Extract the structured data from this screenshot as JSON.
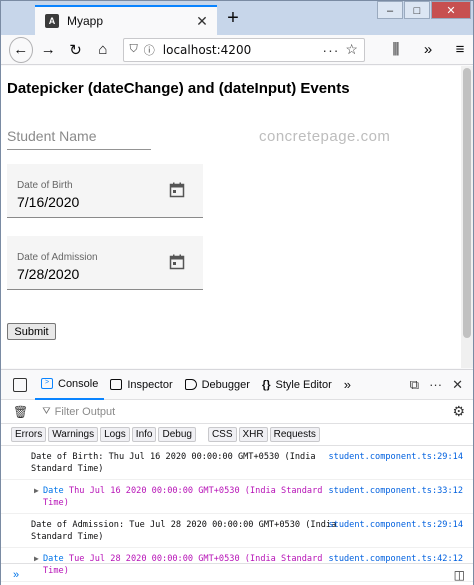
{
  "tab": {
    "title": "Myapp",
    "favicon": "angular-icon"
  },
  "window": {
    "controls": [
      "minimize",
      "maximize",
      "close"
    ]
  },
  "nav": {
    "url": "localhost:4200"
  },
  "page": {
    "title": "Datepicker (dateChange) and (dateInput) Events",
    "student_placeholder": "Student Name",
    "watermark": "concretepage.com",
    "dob": {
      "label": "Date of Birth",
      "value": "7/16/2020"
    },
    "doa": {
      "label": "Date of Admission",
      "value": "7/28/2020"
    },
    "submit_label": "Submit"
  },
  "devtools": {
    "tabs": [
      "Console",
      "Inspector",
      "Debugger",
      "Style Editor"
    ],
    "filter_placeholder": "Filter Output",
    "levels": [
      "Errors",
      "Warnings",
      "Logs",
      "Info",
      "Debug"
    ],
    "types": [
      "CSS",
      "XHR",
      "Requests"
    ],
    "logs": [
      {
        "text": "Date of Birth: Thu Jul 16 2020 00:00:00 GMT+0530 (India Standard Time)",
        "source": "student.component.ts:29:14",
        "kind": "text"
      },
      {
        "prefix": "Date",
        "text": "Thu Jul 16 2020 00:00:00 GMT+0530 (India Standard Time)",
        "source": "student.component.ts:33:12",
        "kind": "object"
      },
      {
        "text": "Date of Admission: Tue Jul 28 2020 00:00:00 GMT+0530 (India Standard Time)",
        "source": "student.component.ts:29:14",
        "kind": "text"
      },
      {
        "prefix": "Date",
        "text": "Tue Jul 28 2020 00:00:00 GMT+0530 (India Standard Time)",
        "source": "student.component.ts:42:12",
        "kind": "object"
      }
    ],
    "prompt": "»"
  },
  "colors": {
    "accent": "#0a84ff",
    "object_text": "#b713b7",
    "source_link": "#0060df"
  }
}
